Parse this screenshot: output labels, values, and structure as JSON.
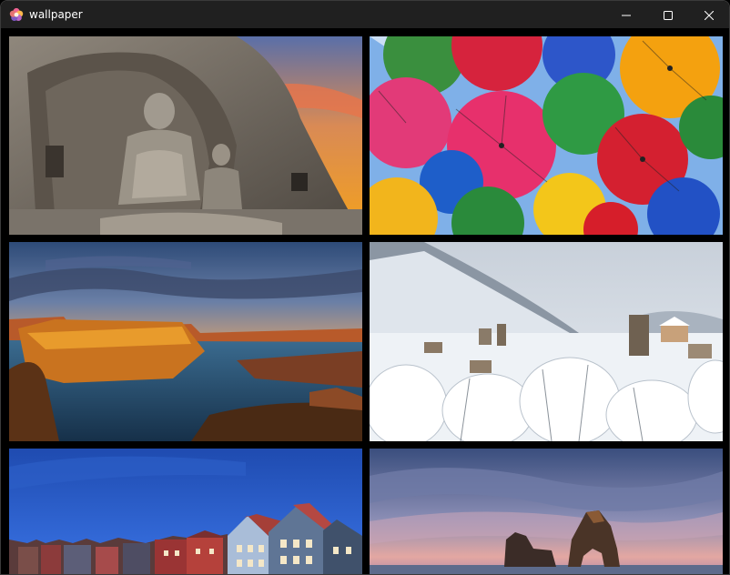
{
  "window": {
    "title": "wallpaper",
    "app_icon": "flower-logo-icon",
    "controls": [
      "minimize-icon",
      "maximize-icon",
      "close-icon"
    ]
  },
  "wallpapers": [
    {
      "id": 1,
      "subject": "rock-carved-buddha-statues-at-sunset"
    },
    {
      "id": 2,
      "subject": "colorful-umbrellas-overhead"
    },
    {
      "id": 3,
      "subject": "desert-canyon-lake-at-dusk"
    },
    {
      "id": 4,
      "subject": "snowy-mountain-village"
    },
    {
      "id": 5,
      "subject": "colorful-waterfront-houses-blue-sky"
    },
    {
      "id": 6,
      "subject": "sea-stacks-at-twilight"
    }
  ],
  "colors": {
    "titlebar": "#202020",
    "background": "#000000",
    "title_text": "#ffffff",
    "close_hover": "#c42b1c"
  }
}
